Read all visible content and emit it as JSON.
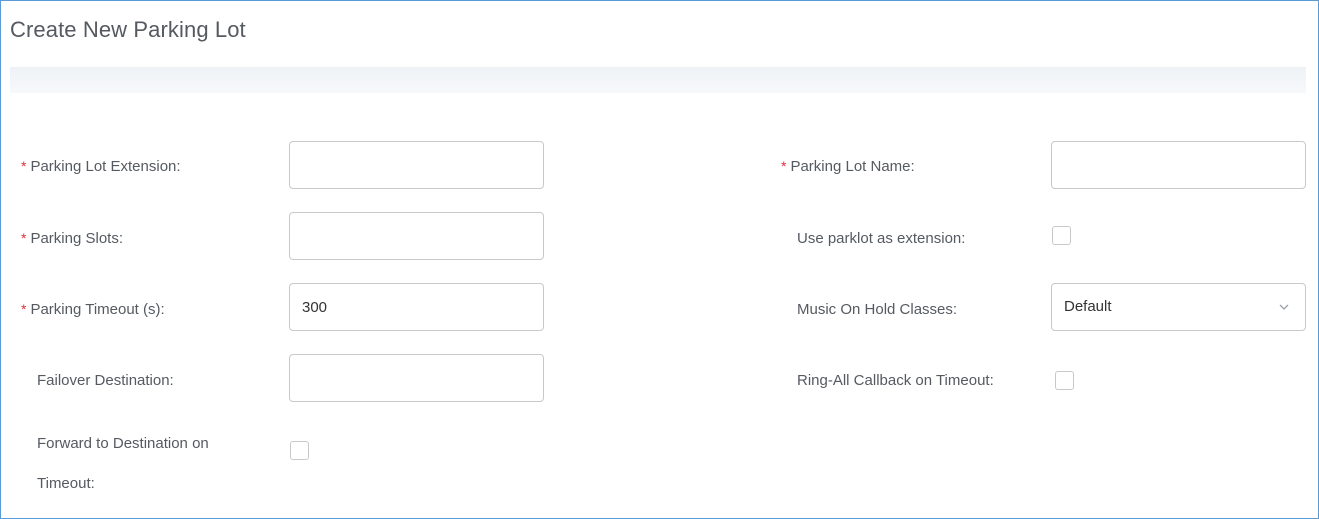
{
  "title": "Create New Parking Lot",
  "required_mark": "*",
  "left": {
    "extension": {
      "label": "Parking Lot Extension:",
      "value": ""
    },
    "slots": {
      "label": "Parking Slots:",
      "value": ""
    },
    "timeout": {
      "label": "Parking Timeout (s):",
      "value": "300"
    },
    "failover": {
      "label": "Failover Destination:",
      "value": ""
    },
    "forward": {
      "label": "Forward to Destination on Timeout:",
      "checked": false
    }
  },
  "right": {
    "name": {
      "label": "Parking Lot Name:",
      "value": ""
    },
    "use_parklot": {
      "label": "Use parklot as extension:",
      "checked": false
    },
    "moh": {
      "label": "Music On Hold Classes:",
      "selected": "Default"
    },
    "ring_all": {
      "label": "Ring-All Callback on Timeout:",
      "checked": false
    }
  },
  "colors": {
    "frame_border": "#5b9bd5",
    "required": "#e0303a",
    "label_text": "#555a60",
    "input_border": "#c9c9c9"
  },
  "icons": {
    "select_arrow": "chevron-down-icon"
  }
}
